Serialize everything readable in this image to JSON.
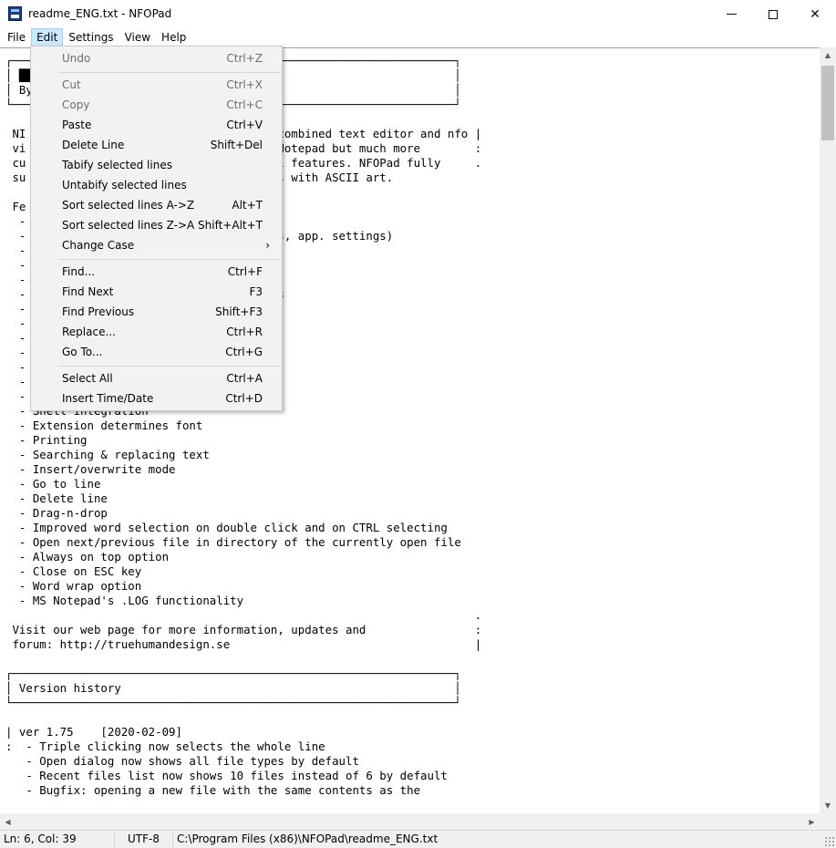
{
  "window": {
    "title": "readme_ENG.txt - NFOPad",
    "minimize_symbol": "",
    "maximize_symbol": "",
    "close_symbol": "✕"
  },
  "menubar": {
    "items": [
      {
        "label": "File"
      },
      {
        "label": "Edit"
      },
      {
        "label": "Settings"
      },
      {
        "label": "View"
      },
      {
        "label": "Help"
      }
    ]
  },
  "edit_menu": {
    "items": [
      {
        "label": "Undo",
        "shortcut": "Ctrl+Z",
        "disabled": true
      },
      {
        "label": "Cut",
        "shortcut": "Ctrl+X",
        "disabled": true
      },
      {
        "label": "Copy",
        "shortcut": "Ctrl+C",
        "disabled": true
      },
      {
        "label": "Paste",
        "shortcut": "Ctrl+V",
        "disabled": false
      },
      {
        "label": "Delete Line",
        "shortcut": "Shift+Del",
        "disabled": false
      },
      {
        "label": "Tabify selected lines",
        "shortcut": "",
        "disabled": false
      },
      {
        "label": "Untabify selected lines",
        "shortcut": "",
        "disabled": false
      },
      {
        "label": "Sort selected lines A->Z",
        "shortcut": "Alt+T",
        "disabled": false
      },
      {
        "label": "Sort selected lines Z->A",
        "shortcut": "Shift+Alt+T",
        "disabled": false
      },
      {
        "label": "Change Case",
        "shortcut": "",
        "disabled": false,
        "submenu_arrow": "›"
      },
      {
        "label": "Find...",
        "shortcut": "Ctrl+F",
        "disabled": false
      },
      {
        "label": "Find Next",
        "shortcut": "F3",
        "disabled": false
      },
      {
        "label": "Find Previous",
        "shortcut": "Shift+F3",
        "disabled": false
      },
      {
        "label": "Replace...",
        "shortcut": "Ctrl+R",
        "disabled": false
      },
      {
        "label": "Go To...",
        "shortcut": "Ctrl+G",
        "disabled": false
      },
      {
        "label": "Select All",
        "shortcut": "Ctrl+A",
        "disabled": false
      },
      {
        "label": "Insert Time/Date",
        "shortcut": "Ctrl+D",
        "disabled": false
      }
    ]
  },
  "editor": {
    "content": "┌─────────────────────────────────────────────────────────────────┐\n│ ██╗                                                             │\n│ By                                                              │\n└─────────────────────────────────────────────────────────────────┘\n\n NI                                     combined text editor and nfo |\n vi                                     Notepad but much more        :\n cu                                     l features. NFOPad fully     .\n su                                     s with ASCII art.\n\n Fe\n  -\n  -                                     s, app. settings)\n  -\n  -\n  -\n  -                                     s\n  -\n  -\n  -\n  -\n  -\n  -\n  -\n  - Shell integration\n  - Extension determines font\n  - Printing\n  - Searching & replacing text\n  - Insert/overwrite mode\n  - Go to line\n  - Delete line\n  - Drag-n-drop\n  - Improved word selection on double click and on CTRL selecting\n  - Open next/previous file in directory of the currently open file\n  - Always on top option\n  - Close on ESC key\n  - Word wrap option\n  - MS Notepad's .LOG functionality\n                                                                     .\n Visit our web page for more information, updates and                :\n forum: http://truehumandesign.se                                    |\n\n┌─────────────────────────────────────────────────────────────────┐\n│ Version history                                                 │\n└─────────────────────────────────────────────────────────────────┘\n\n| ver 1.75    [2020-02-09]\n:  - Triple clicking now selects the whole line\n   - Open dialog now shows all file types by default\n   - Recent files list now shows 10 files instead of 6 by default\n   - Bugfix: opening a new file with the same contents as the"
  },
  "scrollbars": {
    "up": "▲",
    "down": "▼",
    "left": "◀",
    "right": "▶",
    "vertical_position_fraction": 0.02
  },
  "statusbar": {
    "position": "Ln: 6, Col: 39",
    "encoding": "UTF-8",
    "path": "C:\\Program Files (x86)\\NFOPad\\readme_ENG.txt"
  }
}
